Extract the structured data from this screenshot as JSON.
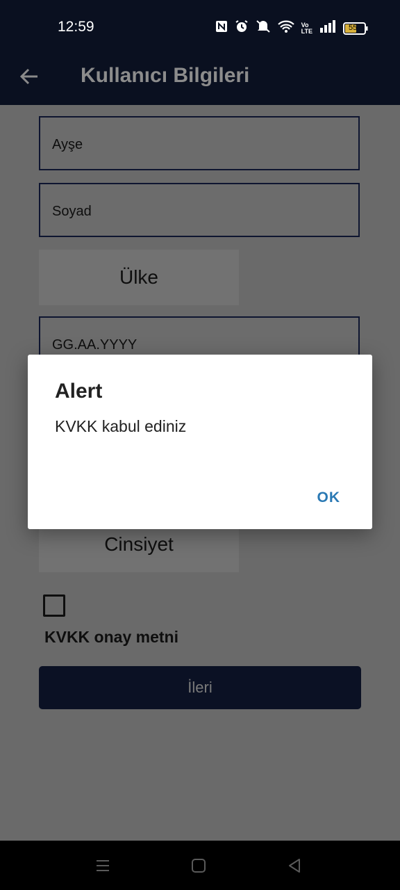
{
  "status_bar": {
    "time": "12:59",
    "battery": "55",
    "icons": [
      "nfc-icon",
      "alarm-icon",
      "mute-icon",
      "wifi-icon",
      "volte-icon",
      "signal-icon",
      "battery-icon"
    ]
  },
  "app_bar": {
    "title": "Kullanıcı Bilgileri"
  },
  "form": {
    "first_name_value": "Ayşe",
    "last_name_placeholder": "Soyad",
    "country_label": "Ülke",
    "birthdate_placeholder": "GG.AA.YYYY",
    "gender_label": "Cinsiyet",
    "kvkk_label": "KVKK onay metni",
    "kvkk_checked": false,
    "next_button": "İleri"
  },
  "dialog": {
    "title": "Alert",
    "message": "KVKK kabul ediniz",
    "ok": "OK"
  },
  "colors": {
    "appbar": "#0a1020",
    "scrim_bg": "#6a6a6a",
    "accent_ok": "#2a79b4"
  }
}
